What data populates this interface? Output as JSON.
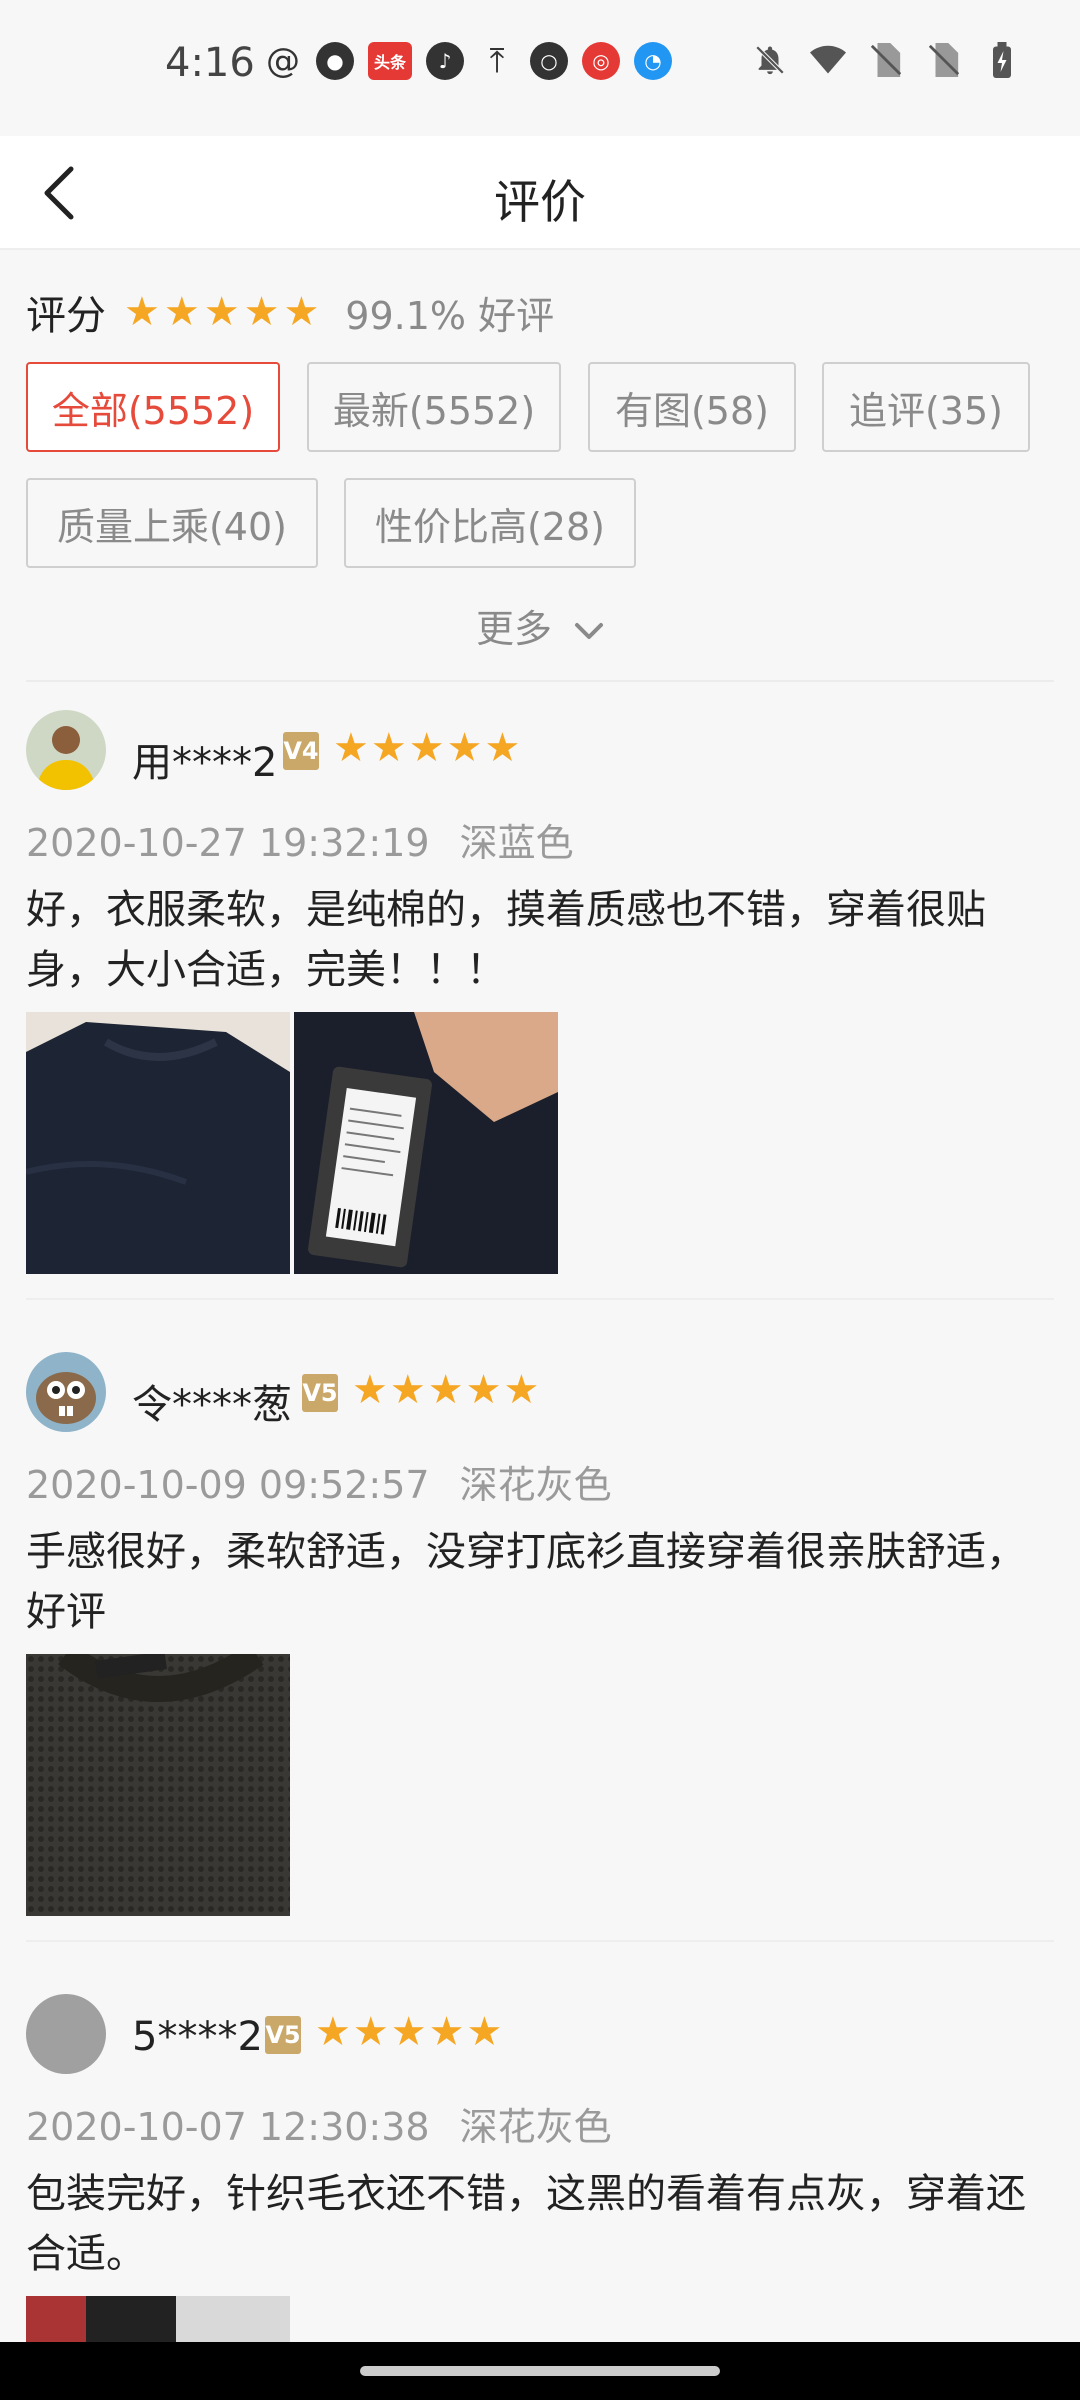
{
  "status_bar": {
    "time": "4:16",
    "left_icons": [
      "swirl-icon",
      "ghost-icon",
      "toutiao-icon",
      "tiktok-icon",
      "upload-icon",
      "chat-icon",
      "netease-music-icon",
      "browser-icon"
    ],
    "toutiao_label": "头条",
    "right_icons": [
      "bell-off-icon",
      "wifi-icon",
      "no-sim-icon",
      "no-sim-icon",
      "battery-charging-icon"
    ]
  },
  "header": {
    "title": "评价"
  },
  "rating": {
    "label": "评分",
    "stars": 5,
    "good_rate": "99.1% 好评"
  },
  "filters": [
    {
      "label": "全部(5552)",
      "active": true
    },
    {
      "label": "最新(5552)",
      "active": false
    },
    {
      "label": "有图(58)",
      "active": false
    },
    {
      "label": "追评(35)",
      "active": false
    },
    {
      "label": "质量上乘(40)",
      "active": false
    },
    {
      "label": "性价比高(28)",
      "active": false
    }
  ],
  "more": {
    "label": "更多"
  },
  "reviews": [
    {
      "user": "用****2",
      "level": "V4",
      "stars": 5,
      "date": "2020-10-27 19:32:19",
      "variant": "深蓝色",
      "text": "好，衣服柔软，是纯棉的，摸着质感也不错，穿着很贴身，大小合适，完美！！！",
      "photos": 2
    },
    {
      "user": "令****葱",
      "level": "V5",
      "stars": 5,
      "date": "2020-10-09 09:52:57",
      "variant": "深花灰色",
      "text": "手感很好，柔软舒适，没穿打底衫直接穿着很亲肤舒适，好评",
      "photos": 1
    },
    {
      "user": "5****2",
      "level": "V5",
      "stars": 5,
      "date": "2020-10-07 12:30:38",
      "variant": "深花灰色",
      "text": "包装完好，针织毛衣还不错，这黑的看着有点灰，穿着还合适。",
      "photos": 1
    }
  ],
  "colors": {
    "accent": "#e64a3b",
    "star": "#f5a623",
    "badge": "#c9a86a"
  }
}
